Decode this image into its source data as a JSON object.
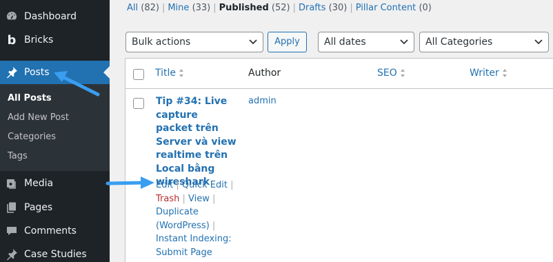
{
  "sidebar": {
    "items": [
      {
        "label": "Dashboard",
        "icon": "dashboard-icon"
      },
      {
        "label": "Bricks",
        "icon": "bricks-logo-icon"
      },
      {
        "label": "Posts",
        "icon": "pin-icon"
      },
      {
        "label": "Media",
        "icon": "media-icon"
      },
      {
        "label": "Pages",
        "icon": "pages-icon"
      },
      {
        "label": "Comments",
        "icon": "comment-icon"
      },
      {
        "label": "Case Studies",
        "icon": "pin-icon"
      }
    ],
    "submenu": [
      "All Posts",
      "Add New Post",
      "Categories",
      "Tags"
    ],
    "active_color": "#2271b1",
    "background": "#1d2327"
  },
  "filters": [
    {
      "label": "All",
      "count": "(82)"
    },
    {
      "label": "Mine",
      "count": "(33)"
    },
    {
      "label": "Published",
      "count": "(52)"
    },
    {
      "label": "Drafts",
      "count": "(30)"
    },
    {
      "label": "Pillar Content",
      "count": "(0)"
    }
  ],
  "toolbar": {
    "bulk_actions": "Bulk actions",
    "apply": "Apply",
    "dates": "All dates",
    "categories": "All Categories"
  },
  "table": {
    "columns": [
      "Title",
      "Author",
      "SEO",
      "Writer"
    ],
    "row": {
      "title": "Tip #34: Live capture packet trên Server và view realtime trên Local bằng wireshark",
      "author": "admin",
      "actions": {
        "edit": "Edit",
        "quick_edit": "Quick Edit",
        "trash": "Trash",
        "view": "View",
        "duplicate": "Duplicate (WordPress)",
        "instant_indexing": "Instant Indexing: Submit Page"
      }
    }
  },
  "annotation_color": "#3a9ef0"
}
